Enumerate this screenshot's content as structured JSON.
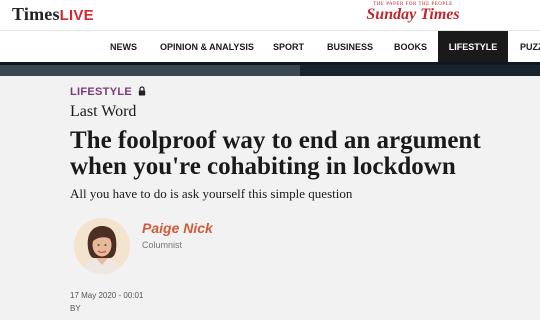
{
  "header": {
    "times_logo": "Times",
    "live_logo": "LIVE",
    "sunday_tagline": "THE PAPER FOR THE PEOPLE",
    "sunday_logo": "Sunday Times"
  },
  "nav": {
    "items": [
      {
        "label": "NEWS"
      },
      {
        "label": "OPINION & ANALYSIS"
      },
      {
        "label": "SPORT"
      },
      {
        "label": "BUSINESS"
      },
      {
        "label": "BOOKS"
      },
      {
        "label": "LIFESTYLE",
        "active": true
      },
      {
        "label": "PUZZ"
      }
    ]
  },
  "article": {
    "section": "LIFESTYLE",
    "section_icon": "lock-icon",
    "kicker": "Last Word",
    "headline_line1": "The foolproof way to end an argument",
    "headline_line2": "when you're cohabiting in lockdown",
    "standfirst": "All you have to do is ask yourself this simple question"
  },
  "author": {
    "name": "Paige Nick",
    "role": "Columnist"
  },
  "meta": {
    "date": "17 May 2020 - 00:01",
    "byline": "BY"
  },
  "colors": {
    "section": "#7b3a7c",
    "author": "#cf5b3a",
    "live": "#d6282c",
    "nav_active_bg": "#1a1a1a",
    "nav_active_underline": "#9d6aa3"
  }
}
